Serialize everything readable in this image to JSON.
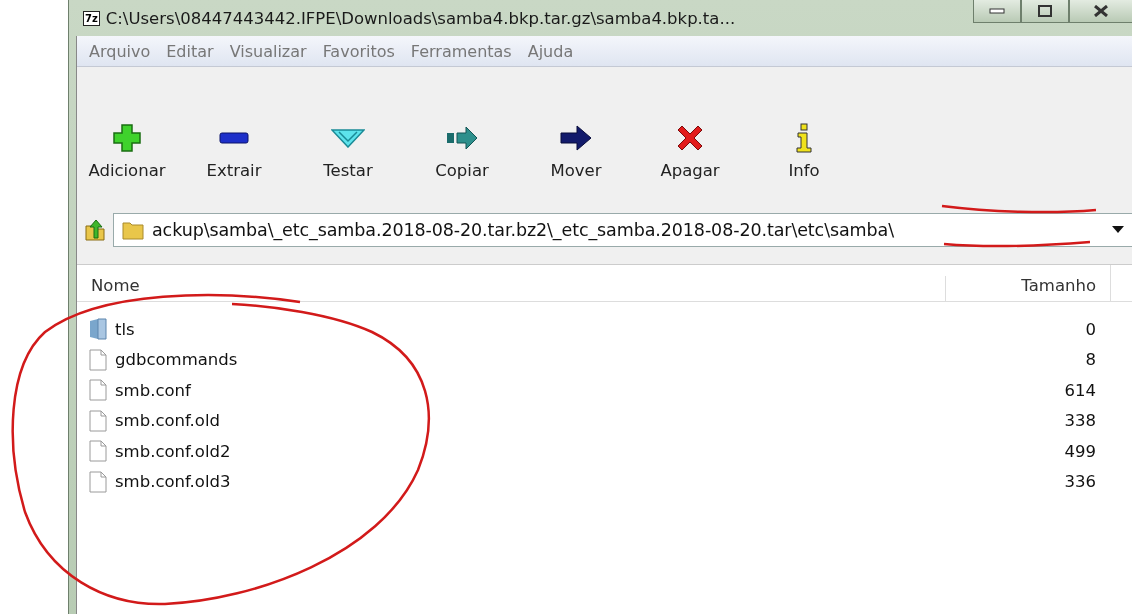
{
  "window": {
    "app_icon": "7z",
    "title": "C:\\Users\\08447443442.IFPE\\Downloads\\samba4.bkp.tar.gz\\samba4.bkp.ta..."
  },
  "menu": [
    "Arquivo",
    "Editar",
    "Visualizar",
    "Favoritos",
    "Ferramentas",
    "Ajuda"
  ],
  "toolbar": [
    {
      "label": "Adicionar",
      "kind": "add"
    },
    {
      "label": "Extrair",
      "kind": "extract"
    },
    {
      "label": "Testar",
      "kind": "test"
    },
    {
      "label": "Copiar",
      "kind": "copy"
    },
    {
      "label": "Mover",
      "kind": "move"
    },
    {
      "label": "Apagar",
      "kind": "delete"
    },
    {
      "label": "Info",
      "kind": "info"
    }
  ],
  "address": {
    "path": "ackup\\samba\\_etc_samba.2018-08-20.tar.bz2\\_etc_samba.2018-08-20.tar\\etc\\samba\\"
  },
  "columns": [
    "Nome",
    "Tamanho"
  ],
  "rows": [
    {
      "name": "tls",
      "kind": "folder",
      "size": "0"
    },
    {
      "name": "gdbcommands",
      "kind": "file",
      "size": "8"
    },
    {
      "name": "smb.conf",
      "kind": "file",
      "size": "614"
    },
    {
      "name": "smb.conf.old",
      "kind": "file",
      "size": "338"
    },
    {
      "name": "smb.conf.old2",
      "kind": "file",
      "size": "499"
    },
    {
      "name": "smb.conf.old3",
      "kind": "file",
      "size": "336"
    }
  ]
}
